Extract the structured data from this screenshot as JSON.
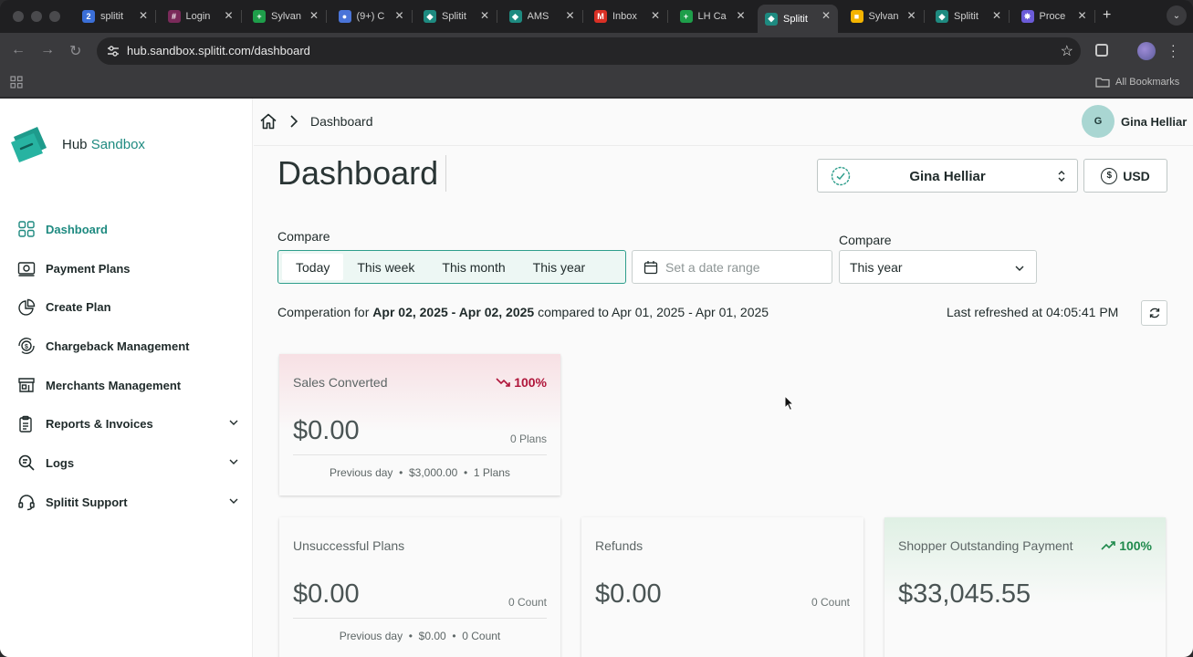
{
  "browser": {
    "tabs": [
      {
        "title": "splitit",
        "color": "#3b6fd8",
        "glyph": "2"
      },
      {
        "title": "Login",
        "color": "#7a2a5a",
        "glyph": "#"
      },
      {
        "title": "Sylvan",
        "color": "#1e9e4a",
        "glyph": "+"
      },
      {
        "title": "(9+) C",
        "color": "#4a74d8",
        "glyph": "●"
      },
      {
        "title": "Splitit",
        "color": "#1e8a80",
        "glyph": "◆"
      },
      {
        "title": "AMS",
        "color": "#1e8a80",
        "glyph": "◆"
      },
      {
        "title": "Inbox",
        "color": "#d93025",
        "glyph": "M"
      },
      {
        "title": "LH Ca",
        "color": "#1e9e4a",
        "glyph": "+"
      },
      {
        "title": "Splitit",
        "color": "#1e8a80",
        "glyph": "◆"
      },
      {
        "title": "Sylvan",
        "color": "#f4b400",
        "glyph": "■"
      },
      {
        "title": "Splitit",
        "color": "#1e8a80",
        "glyph": "◆"
      },
      {
        "title": "Proce",
        "color": "#6b5bd8",
        "glyph": "✸"
      }
    ],
    "active_tab": 8,
    "url": "hub.sandbox.splitit.com/dashboard",
    "bookmarks_label": "All Bookmarks"
  },
  "logo": {
    "prefix": "Hub",
    "suffix": "Sandbox"
  },
  "sidebar": {
    "items": [
      {
        "label": "Dashboard",
        "icon": "grid-icon",
        "active": true
      },
      {
        "label": "Payment Plans",
        "icon": "cash-icon"
      },
      {
        "label": "Create Plan",
        "icon": "pie-icon"
      },
      {
        "label": "Chargeback Management",
        "icon": "coin-cycle-icon"
      },
      {
        "label": "Merchants Management",
        "icon": "store-icon"
      },
      {
        "label": "Reports & Invoices",
        "icon": "clipboard-icon",
        "expandable": true
      },
      {
        "label": "Logs",
        "icon": "search-doc-icon",
        "expandable": true
      },
      {
        "label": "Splitit Support",
        "icon": "headset-icon",
        "expandable": true
      }
    ]
  },
  "header": {
    "breadcrumb": "Dashboard",
    "avatar_initial": "G",
    "user_name": "Gina Helliar"
  },
  "page": {
    "title": "Dashboard",
    "merchant": "Gina Helliar",
    "currency": "USD",
    "compare_label": "Compare",
    "compare_options": [
      "Today",
      "This week",
      "This month",
      "This year"
    ],
    "compare_selected": "Today",
    "date_range_placeholder": "Set a date range",
    "compare2_label": "Compare",
    "compare2_value": "This year",
    "comparison": {
      "prefix": "Comperation for",
      "range1": "Apr 02, 2025 - Apr 02, 2025",
      "middle": "compared to",
      "range2": "Apr 01, 2025 - Apr 01, 2025"
    },
    "last_refreshed_label": "Last refreshed at",
    "last_refreshed_time": "04:05:41 PM"
  },
  "cards": {
    "sales": {
      "title": "Sales Converted",
      "trend": "100%",
      "trend_color": "#b0163b",
      "amount": "$0.00",
      "count": "0 Plans",
      "prev_label": "Previous day",
      "prev_amount": "$3,000.00",
      "prev_count": "1 Plans"
    },
    "unsuccessful": {
      "title": "Unsuccessful Plans",
      "amount": "$0.00",
      "count": "0 Count",
      "prev_label": "Previous day",
      "prev_amount": "$0.00",
      "prev_count": "0 Count"
    },
    "refunds": {
      "title": "Refunds",
      "amount": "$0.00",
      "count": "0 Count"
    },
    "outstanding": {
      "title": "Shopper Outstanding Payment",
      "trend": "100%",
      "trend_color": "#1f8a4c",
      "amount": "$33,045.55"
    }
  }
}
